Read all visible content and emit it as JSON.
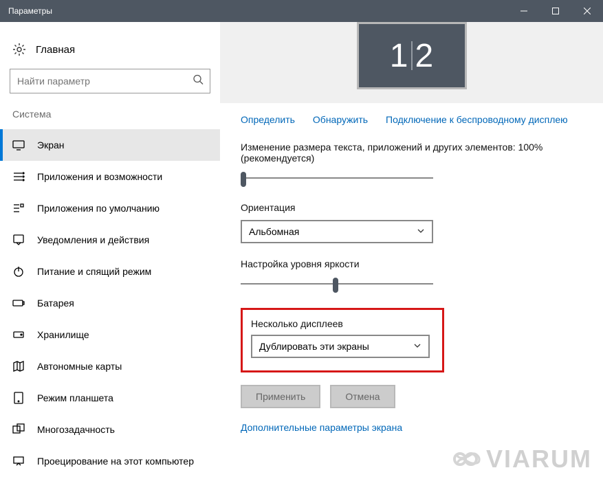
{
  "window": {
    "title": "Параметры"
  },
  "sidebar": {
    "home": "Главная",
    "search_placeholder": "Найти параметр",
    "section": "Система",
    "items": [
      {
        "label": "Экран"
      },
      {
        "label": "Приложения и возможности"
      },
      {
        "label": "Приложения по умолчанию"
      },
      {
        "label": "Уведомления и действия"
      },
      {
        "label": "Питание и спящий режим"
      },
      {
        "label": "Батарея"
      },
      {
        "label": "Хранилище"
      },
      {
        "label": "Автономные карты"
      },
      {
        "label": "Режим планшета"
      },
      {
        "label": "Многозадачность"
      },
      {
        "label": "Проецирование на этот компьютер"
      }
    ]
  },
  "main": {
    "display_label_left": "1",
    "display_label_right": "2",
    "links": {
      "identify": "Определить",
      "detect": "Обнаружить",
      "wireless": "Подключение к беспроводному дисплею"
    },
    "scale_label": "Изменение размера текста, приложений и других элементов: 100% (рекомендуется)",
    "orientation_label": "Ориентация",
    "orientation_value": "Альбомная",
    "brightness_label": "Настройка уровня яркости",
    "multi_label": "Несколько дисплеев",
    "multi_value": "Дублировать эти экраны",
    "apply": "Применить",
    "cancel": "Отмена",
    "advanced": "Дополнительные параметры экрана",
    "watermark": "VIARUM"
  }
}
